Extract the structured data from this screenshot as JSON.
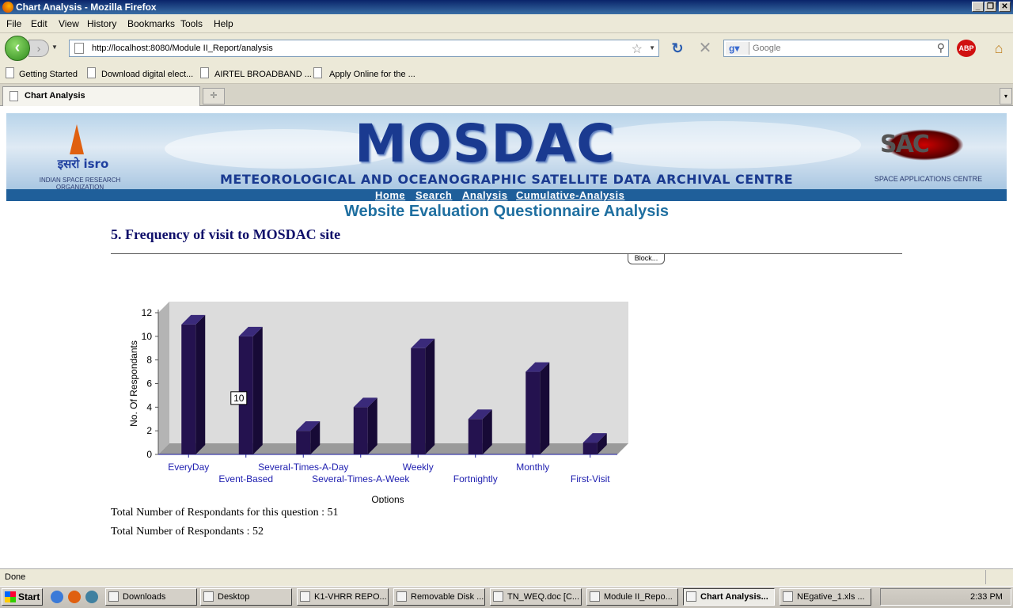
{
  "window": {
    "title": "Chart Analysis - Mozilla Firefox"
  },
  "menu": [
    "File",
    "Edit",
    "View",
    "History",
    "Bookmarks",
    "Tools",
    "Help"
  ],
  "toolbar": {
    "url": "http://localhost:8080/Module II_Report/analysis",
    "search_engine": "Google",
    "search_placeholder": "Google",
    "abp_label": "ABP"
  },
  "bookmarks": [
    "Getting Started",
    "Download digital elect...",
    "AIRTEL BROADBAND ...",
    "Apply Online for the ..."
  ],
  "tabs": [
    {
      "label": "Chart Analysis"
    }
  ],
  "banner": {
    "title": "MOSDAC",
    "subtitle": "METEOROLOGICAL AND OCEANOGRAPHIC SATELLITE DATA ARCHIVAL CENTRE",
    "left_logo_text": "इसरो isro",
    "left_logo_caption": "INDIAN SPACE RESEARCH ORGANIZATION",
    "right_logo_text": "SAC",
    "right_logo_caption": "SPACE APPLICATIONS CENTRE"
  },
  "nav": [
    "Home",
    "Search",
    "Analysis",
    "Cumulative-Analysis"
  ],
  "page": {
    "heading": "Website Evaluation Questionnaire Analysis",
    "question": "5. Frequency of visit to MOSDAC site",
    "block_label": "Block...",
    "total_question": "Total Number of Respondants for this question : 51",
    "total_overall": "Total Number of Respondants : 52"
  },
  "chart_data": {
    "type": "bar",
    "categories": [
      "EveryDay",
      "Event-Based",
      "Several-Times-A-Day",
      "Several-Times-A-Week",
      "Weekly",
      "Fortnightly",
      "Monthly",
      "First-Visit"
    ],
    "values": [
      11,
      10,
      2,
      4,
      9,
      3,
      7,
      1
    ],
    "xlabel": "Options",
    "ylabel": "No. Of Respondants",
    "yticks": [
      0,
      2,
      4,
      6,
      8,
      10,
      12
    ],
    "ylim": [
      0,
      12
    ],
    "tooltip": {
      "category": "Event-Based",
      "value": "10"
    },
    "bar_color": "#24124f",
    "plot_bg": "#dcdcdc"
  },
  "status": {
    "text": "Done"
  },
  "taskbar": {
    "start": "Start",
    "tasks": [
      "Downloads",
      "Desktop",
      "K1-VHRR REPO...",
      "Removable Disk ...",
      "TN_WEQ.doc [C...",
      "Module II_Repo...",
      "Chart Analysis...",
      "NEgative_1.xls ..."
    ],
    "active_index": 6,
    "clock": "2:33 PM"
  }
}
